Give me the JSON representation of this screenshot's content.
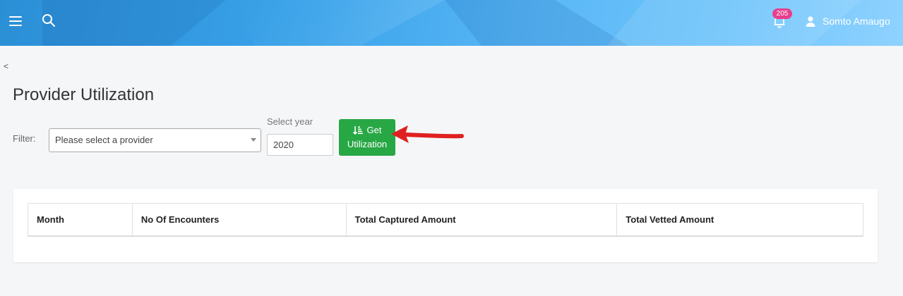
{
  "header": {
    "notifications_count": "205",
    "user_name": "Somto Amaugo"
  },
  "nav": {
    "back_label": "<"
  },
  "page": {
    "title": "Provider Utilization"
  },
  "filter": {
    "label": "Filter:",
    "provider_placeholder": "Please select a provider",
    "year_label": "Select year",
    "year_value": "2020",
    "button_line1": "Get",
    "button_line2": "Utilization"
  },
  "table": {
    "columns": [
      "Month",
      "No Of Encounters",
      "Total Captured Amount",
      "Total Vetted Amount"
    ]
  },
  "colors": {
    "header_gradient_start": "#2b8fd6",
    "primary_button": "#28a745",
    "badge": "#e83e8c",
    "annotation_arrow": "#e02020"
  }
}
